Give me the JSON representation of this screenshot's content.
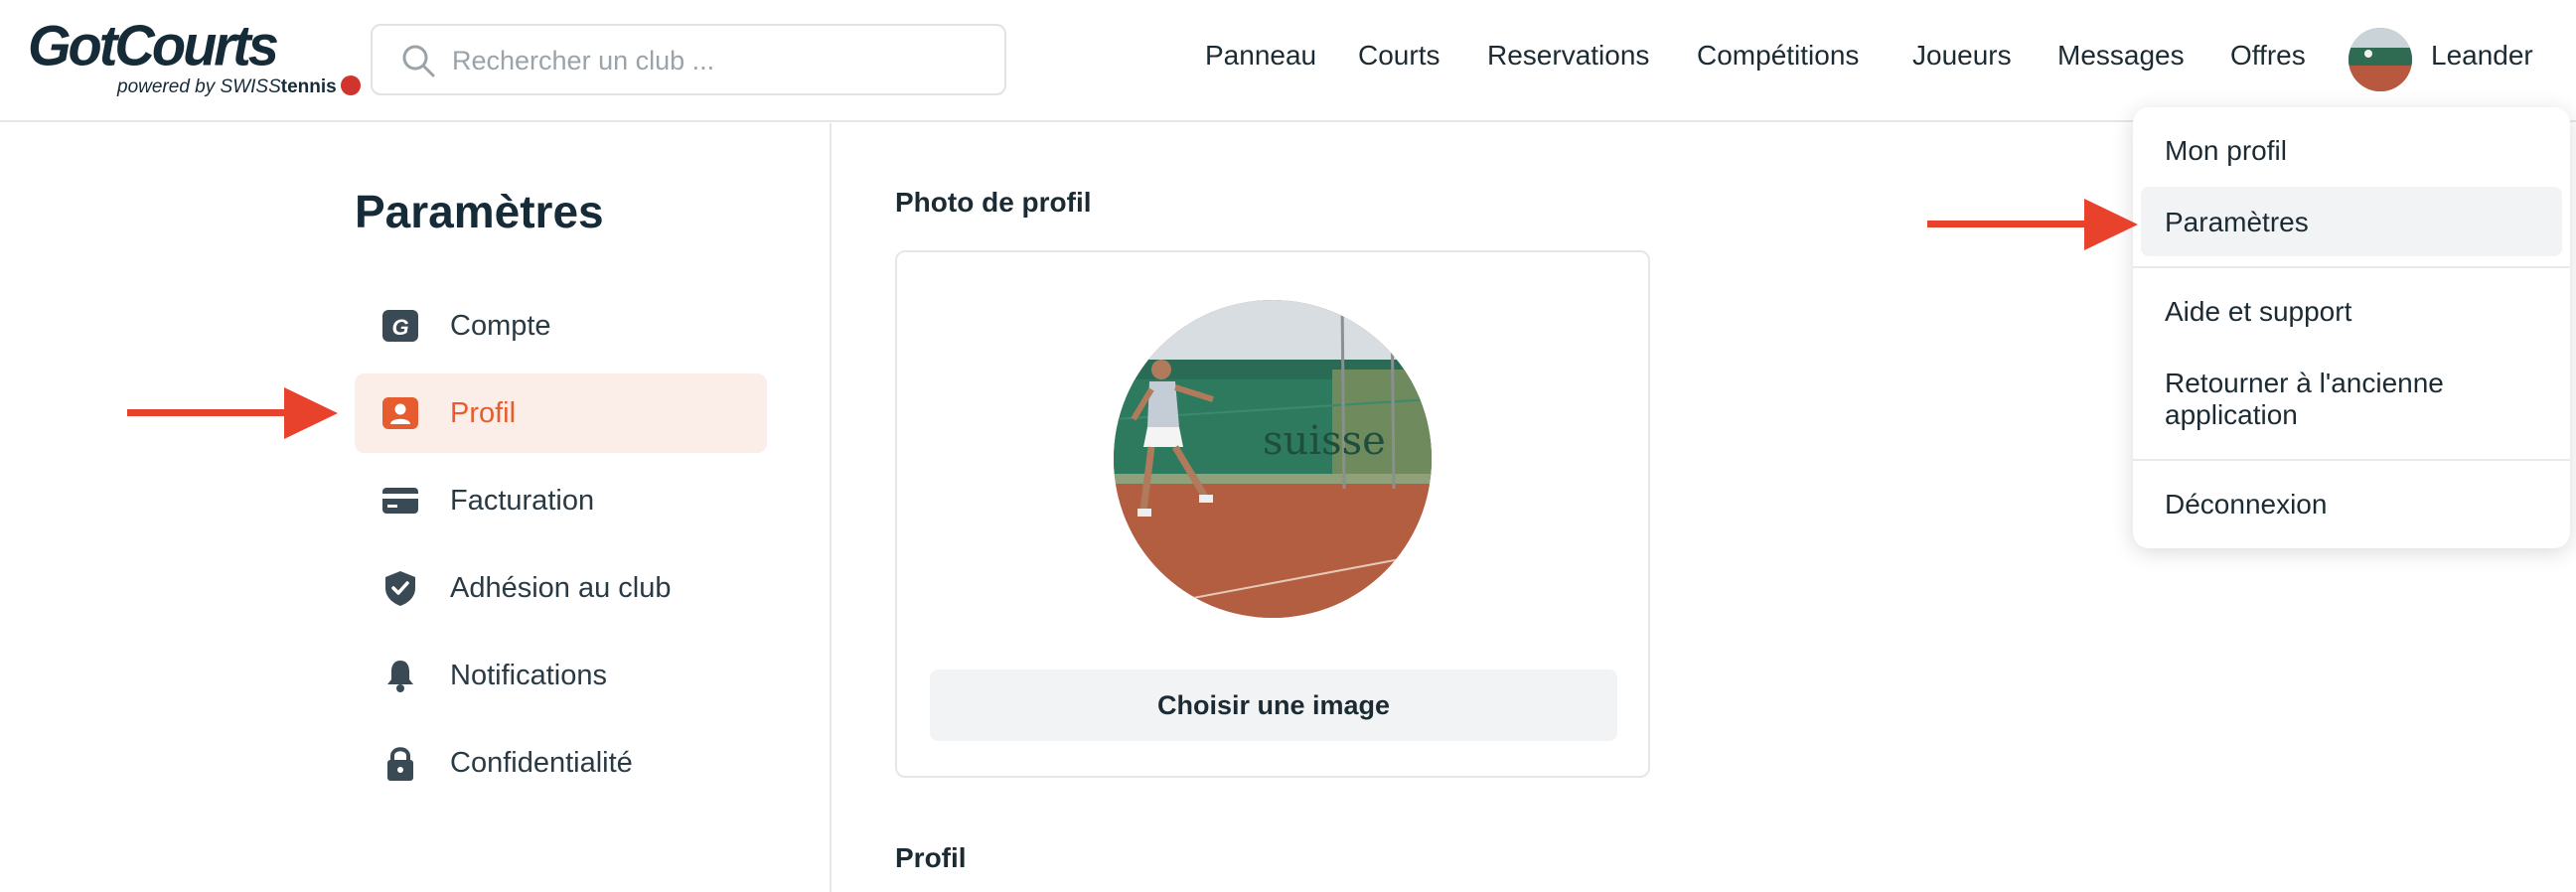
{
  "header": {
    "logo_text": "GotCourts",
    "logo_powered": "powered by",
    "logo_swiss": "SWISS",
    "logo_tennis": "tennis",
    "search_placeholder": "Rechercher un club ...",
    "nav": [
      "Panneau",
      "Courts",
      "Reservations",
      "Compétitions",
      "Joueurs",
      "Messages",
      "Offres"
    ],
    "user_name": "Leander"
  },
  "dropdown": {
    "items": [
      "Mon profil",
      "Paramètres",
      "Aide et support",
      "Retourner à l'ancienne",
      "application",
      "Déconnexion"
    ]
  },
  "sidebar": {
    "title": "Paramètres",
    "items": [
      {
        "label": "Compte",
        "icon": "account-g-icon"
      },
      {
        "label": "Profil",
        "icon": "profile-icon"
      },
      {
        "label": "Facturation",
        "icon": "credit-card-icon"
      },
      {
        "label": "Adhésion au club",
        "icon": "shield-check-icon"
      },
      {
        "label": "Notifications",
        "icon": "bell-icon"
      },
      {
        "label": "Confidentialité",
        "icon": "lock-icon"
      }
    ],
    "active_index": 1
  },
  "main": {
    "photo_title": "Photo de profil",
    "choose_button": "Choisir une image",
    "profile_title": "Profil",
    "photo_banner_text": "suisse"
  },
  "colors": {
    "accent": "#e65c2e",
    "active_bg": "#fbede8",
    "arrow": "#e8412c",
    "text": "#1c2b33"
  }
}
